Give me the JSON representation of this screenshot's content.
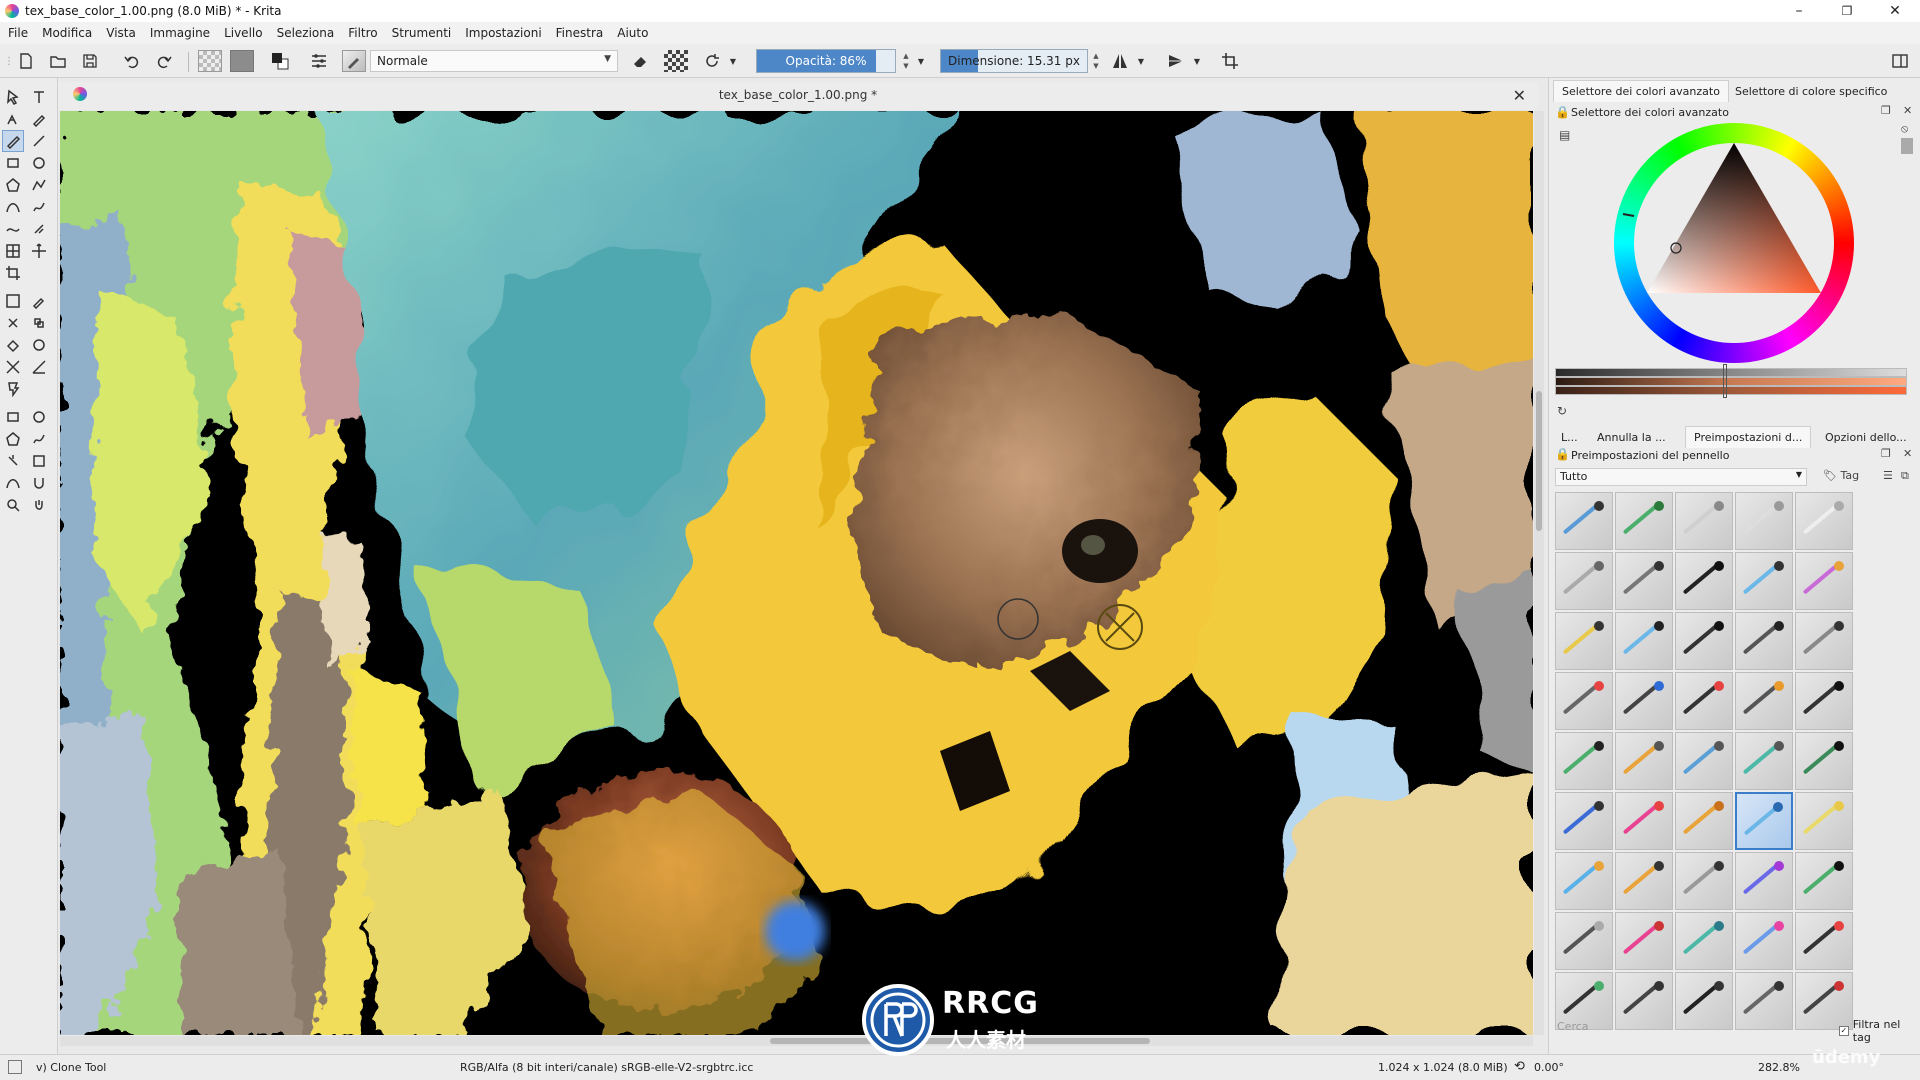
{
  "window": {
    "title": "tex_base_color_1.00.png (8.0 MiB)  * - Krita",
    "controls": {
      "minimize": "–",
      "maximize": "❐",
      "close": "✕"
    }
  },
  "menu": [
    "File",
    "Modifica",
    "Vista",
    "Immagine",
    "Livello",
    "Seleziona",
    "Filtro",
    "Strumenti",
    "Impostazioni",
    "Finestra",
    "Aiuto"
  ],
  "toolbar": {
    "blend_mode": "Normale",
    "opacity_label": "Opacità: 86%",
    "opacity_value": 0.86,
    "size_label": "Dimensione: 15.31 px",
    "size_fill_fraction": 0.25
  },
  "document": {
    "tab_title": "tex_base_color_1.00.png *",
    "close_glyph": "✕"
  },
  "dock": {
    "color_tabs": [
      "Selettore dei colori avanzato",
      "Selettore di colore specifico"
    ],
    "color_panel_title": "Selettore dei colori avanzato",
    "mid_tabs": [
      "L...",
      "Annulla la ...",
      "Preimpostazioni d...",
      "Opzioni dello..."
    ],
    "brush_panel_title": "Preimpostazioni del pennello",
    "brush_filter": "Tutto",
    "tag_label": "Tag",
    "search_placeholder": "Cerca",
    "filter_tag_label": "Filtra nel tag"
  },
  "status": {
    "tool": "v) Clone Tool",
    "color_space": "RGB/Alfa (8 bit interi/canale)  sRGB-elle-V2-srgbtrc.icc",
    "image_size": "1.024 x 1.024 (8.0 MiB)",
    "rotation": "0.00°",
    "zoom": "282.8%"
  },
  "watermark": {
    "brand": "RRCG",
    "brand_sub": "人人素材",
    "course": "ūdemy"
  },
  "colors": {
    "accent": "#4d87c7",
    "selection": "#3b7dc9",
    "panel_bg": "#ececec",
    "canvas_bg": "#000000"
  },
  "brush_presets": [
    {
      "stroke": "#5a9ad6",
      "tip": "#333"
    },
    {
      "stroke": "#4cae6c",
      "tip": "#2a7a3a"
    },
    {
      "stroke": "#cfcfcf",
      "tip": "#888"
    },
    {
      "stroke": "#ddd",
      "tip": "#999"
    },
    {
      "stroke": "#eee",
      "tip": "#aaa"
    },
    {
      "stroke": "#aaa",
      "tip": "#666"
    },
    {
      "stroke": "#777",
      "tip": "#333"
    },
    {
      "stroke": "#222",
      "tip": "#111"
    },
    {
      "stroke": "#6ab7e8",
      "tip": "#333"
    },
    {
      "stroke": "#c86bd6",
      "tip": "#e7a33a"
    },
    {
      "stroke": "#e8c94a",
      "tip": "#333"
    },
    {
      "stroke": "#6ab7e8",
      "tip": "#222"
    },
    {
      "stroke": "#333",
      "tip": "#111"
    },
    {
      "stroke": "#555",
      "tip": "#222"
    },
    {
      "stroke": "#888",
      "tip": "#333"
    },
    {
      "stroke": "#666",
      "tip": "#e84343"
    },
    {
      "stroke": "#444",
      "tip": "#2f6bd6"
    },
    {
      "stroke": "#333",
      "tip": "#e84343"
    },
    {
      "stroke": "#555",
      "tip": "#e89a2a"
    },
    {
      "stroke": "#333",
      "tip": "#111"
    },
    {
      "stroke": "#4cae6c",
      "tip": "#222"
    },
    {
      "stroke": "#e8a33a",
      "tip": "#555"
    },
    {
      "stroke": "#5aa0d6",
      "tip": "#555"
    },
    {
      "stroke": "#4cb8a8",
      "tip": "#555"
    },
    {
      "stroke": "#3a8a5a",
      "tip": "#111"
    },
    {
      "stroke": "#3b6bd6",
      "tip": "#333"
    },
    {
      "stroke": "#e84393",
      "tip": "#e84343"
    },
    {
      "stroke": "#e8a33a",
      "tip": "#c8701a"
    },
    {
      "stroke": "#6ab7e8",
      "tip": "#2a6ab0"
    },
    {
      "stroke": "#e8d96a",
      "tip": "#e8c94a"
    },
    {
      "stroke": "#5ab0e8",
      "tip": "#e8a33a"
    },
    {
      "stroke": "#e8a33a",
      "tip": "#333"
    },
    {
      "stroke": "#999",
      "tip": "#333"
    },
    {
      "stroke": "#6a6ae8",
      "tip": "#a33ad6"
    },
    {
      "stroke": "#4cae6c",
      "tip": "#111"
    },
    {
      "stroke": "#555",
      "tip": "#aaa"
    },
    {
      "stroke": "#e84393",
      "tip": "#c33"
    },
    {
      "stroke": "#4cb8a8",
      "tip": "#2a7a8a"
    },
    {
      "stroke": "#6a9ae8",
      "tip": "#e843a3"
    },
    {
      "stroke": "#333",
      "tip": "#e84343"
    },
    {
      "stroke": "#333",
      "tip": "#4cae6c"
    },
    {
      "stroke": "#444",
      "tip": "#333"
    },
    {
      "stroke": "#222",
      "tip": "#333"
    },
    {
      "stroke": "#666",
      "tip": "#333"
    },
    {
      "stroke": "#444",
      "tip": "#c33"
    }
  ]
}
